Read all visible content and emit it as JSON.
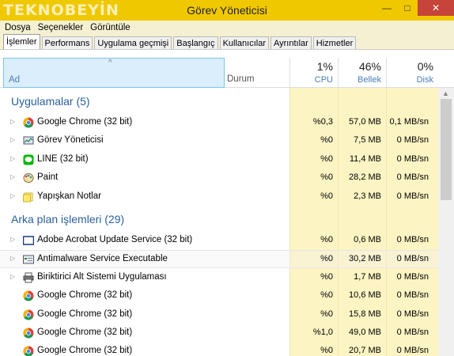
{
  "window": {
    "watermark": "TEKNOBEYİN",
    "title": "Görev Yöneticisi"
  },
  "menu": [
    "Dosya",
    "Seçenekler",
    "Görüntüle"
  ],
  "tabs": [
    "İşlemler",
    "Performans",
    "Uygulama geçmişi",
    "Başlangıç",
    "Kullanıcılar",
    "Ayrıntılar",
    "Hizmetler"
  ],
  "header": {
    "name": "Ad",
    "status": "Durum",
    "cpu_pct": "1%",
    "cpu_label": "CPU",
    "mem_pct": "46%",
    "mem_label": "Bellek",
    "disk_pct": "0%",
    "disk_label": "Disk"
  },
  "colors": {
    "titlebar": "#f0c800",
    "cell_bg": "#fdf4c3",
    "cell_bg_strong": "#f9ea9d",
    "group_text": "#2a5f9e"
  },
  "apps": {
    "title": "Uygulamalar (5)",
    "rows": [
      {
        "name": "Google Chrome (32 bit)",
        "icon": "chrome-icon",
        "cpu": "%0,3",
        "mem": "57,0 MB",
        "disk": "0,1 MB/sn",
        "expand": true
      },
      {
        "name": "Görev Yöneticisi",
        "icon": "task-manager-icon",
        "cpu": "%0",
        "mem": "7,5 MB",
        "disk": "0 MB/sn",
        "expand": true
      },
      {
        "name": "LINE (32 bit)",
        "icon": "line-icon",
        "cpu": "%0",
        "mem": "11,4 MB",
        "disk": "0 MB/sn",
        "expand": true
      },
      {
        "name": "Paint",
        "icon": "paint-icon",
        "cpu": "%0",
        "mem": "28,2 MB",
        "disk": "0 MB/sn",
        "expand": true
      },
      {
        "name": "Yapışkan Notlar",
        "icon": "sticky-notes-icon",
        "cpu": "%0",
        "mem": "2,3 MB",
        "disk": "0 MB/sn",
        "expand": true
      }
    ]
  },
  "background": {
    "title": "Arka plan işlemleri (29)",
    "rows": [
      {
        "name": "Adobe Acrobat Update Service (32 bit)",
        "icon": "window-icon",
        "cpu": "%0",
        "mem": "0,6 MB",
        "disk": "0 MB/sn",
        "expand": true
      },
      {
        "name": "Antimalware Service Executable",
        "icon": "service-icon",
        "cpu": "%0",
        "mem": "30,2 MB",
        "disk": "0 MB/sn",
        "expand": true
      },
      {
        "name": "Biriktirici Alt Sistemi Uygulaması",
        "icon": "printer-icon",
        "cpu": "%0",
        "mem": "1,7 MB",
        "disk": "0 MB/sn",
        "expand": true
      },
      {
        "name": "Google Chrome (32 bit)",
        "icon": "chrome-icon",
        "cpu": "%0",
        "mem": "10,6 MB",
        "disk": "0 MB/sn",
        "expand": false
      },
      {
        "name": "Google Chrome (32 bit)",
        "icon": "chrome-icon",
        "cpu": "%0",
        "mem": "15,8 MB",
        "disk": "0 MB/sn",
        "expand": false
      },
      {
        "name": "Google Chrome (32 bit)",
        "icon": "chrome-icon",
        "cpu": "%1,0",
        "mem": "49,0 MB",
        "disk": "0 MB/sn",
        "expand": false
      },
      {
        "name": "Google Chrome (32 bit)",
        "icon": "chrome-icon",
        "cpu": "%0",
        "mem": "20,7 MB",
        "disk": "0 MB/sn",
        "expand": false
      }
    ]
  }
}
